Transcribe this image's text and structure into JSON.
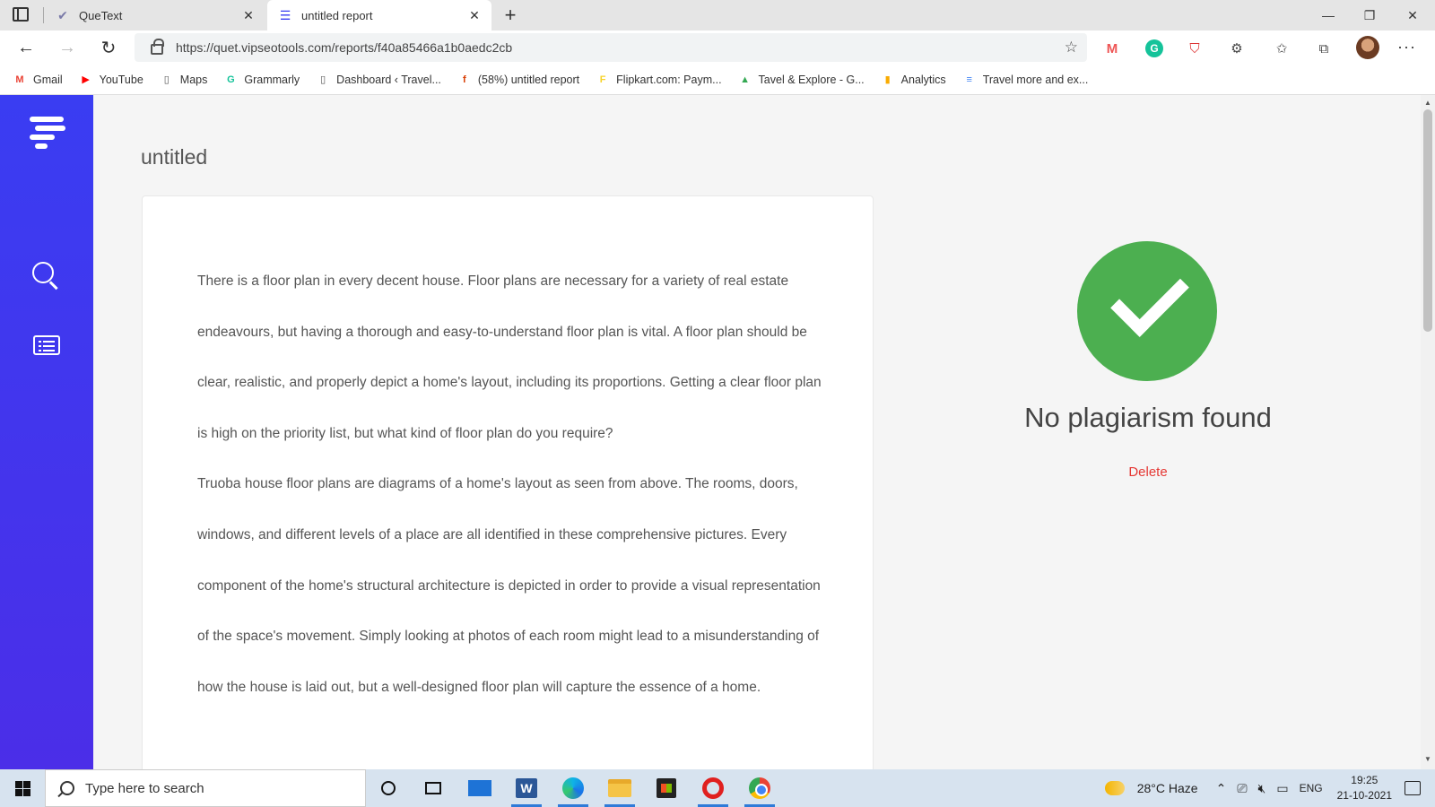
{
  "browser": {
    "tabs": [
      {
        "title": "QueText",
        "icon": "quetext-check-icon"
      },
      {
        "title": "untitled report",
        "icon": "quetext-logo-icon",
        "active": true
      }
    ],
    "url": "https://quet.vipseotools.com/reports/f40a85466a1b0aedc2cb",
    "bookmarks": [
      {
        "label": "Gmail",
        "icon": "gmail-icon",
        "color": "#EA4335"
      },
      {
        "label": "YouTube",
        "icon": "youtube-icon",
        "color": "#FF0000"
      },
      {
        "label": "Maps",
        "icon": "page-icon",
        "color": "#555555"
      },
      {
        "label": "Grammarly",
        "icon": "grammarly-icon",
        "color": "#15C39A"
      },
      {
        "label": "Dashboard ‹ Travel...",
        "icon": "page-icon",
        "color": "#555555"
      },
      {
        "label": "(58%) untitled report",
        "icon": "facebook-icon",
        "color": "#D83B01"
      },
      {
        "label": "Flipkart.com: Paym...",
        "icon": "flipkart-icon",
        "color": "#F7D32A"
      },
      {
        "label": "Tavel & Explore - G...",
        "icon": "drive-icon",
        "color": "#34A853"
      },
      {
        "label": "Analytics",
        "icon": "analytics-icon",
        "color": "#F9AB00"
      },
      {
        "label": "Travel more and ex...",
        "icon": "docs-icon",
        "color": "#4285F4"
      }
    ]
  },
  "page": {
    "doc_title": "untitled",
    "paragraphs": [
      "There is a floor plan in every decent house. Floor plans are necessary for a variety of real estate endeavours, but having a thorough and easy-to-understand floor plan is vital. A floor plan should be clear, realistic, and properly depict a home's layout, including its proportions. Getting a clear floor plan is high on the priority list, but what kind of floor plan do you require?",
      "Truoba house floor plans are diagrams of a home's layout as seen from above. The rooms, doors, windows, and different levels of a place are all identified in these comprehensive pictures. Every component of the home's structural architecture is depicted in order to provide a visual representation of the space's movement. Simply looking at photos of each room might lead to a misunderstanding of how the house is laid out, but a well-designed floor plan will capture the essence of a home."
    ],
    "result_text": "No plagiarism found",
    "delete_label": "Delete",
    "accent_color": "#4CAF50",
    "delete_color": "#E53935",
    "sidebar_color": "#3A3DF2"
  },
  "taskbar": {
    "search_placeholder": "Type here to search",
    "weather": "28°C  Haze",
    "language": "ENG",
    "time": "19:25",
    "date": "21-10-2021"
  }
}
